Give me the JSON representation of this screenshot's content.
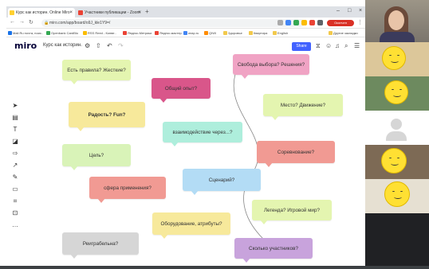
{
  "browser": {
    "tabs": [
      {
        "label": "Курс как историн. Online Miro",
        "favicon_color": "#ffd02f",
        "active": true
      },
      {
        "label": "Участники публикации - Zoom",
        "favicon_color": "#ea4335",
        "active": false
      }
    ],
    "url": "miro.com/app/board/o9J_kle1Y9=/",
    "profile_label": "Окончен",
    "bookmarks": [
      {
        "label": "Mail.Ru почта, поис..",
        "color": "#1a73e8"
      },
      {
        "label": "Openbank CardBlo",
        "color": "#34a853"
      },
      {
        "label": "RSS Reed - Конве..",
        "color": "#fbbc04"
      },
      {
        "label": "Яндекс.Метрики",
        "color": "#ea4335"
      },
      {
        "label": "Яндекс.мастер",
        "color": "#ea4335"
      },
      {
        "label": "wrap.ru",
        "color": "#4285f4"
      },
      {
        "label": "QIWI",
        "color": "#ff8c00"
      },
      {
        "label": "Здоровье",
        "color": "#f2c94c"
      },
      {
        "label": "Квартира",
        "color": "#f2c94c"
      },
      {
        "label": "English",
        "color": "#f2c94c"
      },
      {
        "label": "Другие закладки",
        "color": "#f2c94c"
      }
    ]
  },
  "miro": {
    "logo": "miro",
    "board_name": "Курс как историн.",
    "share_label": "Share"
  },
  "notes": [
    {
      "text": "Есть правила? Жесткие?",
      "color": "#e4f5b0",
      "tail": "left"
    },
    {
      "text": "Общий опыт?",
      "color": "#d9568a",
      "tail": "left"
    },
    {
      "text": "Свобода выбора? Решения?",
      "color": "#f0a3c4",
      "tail": "left"
    },
    {
      "text": "Радость? Fun?",
      "color": "#f7e99b",
      "tail": "left",
      "bold": true
    },
    {
      "text": "Место? Движение?",
      "color": "#e4f5b0",
      "tail": "left"
    },
    {
      "text": "взаимодействие через...?",
      "color": "#aeeedc",
      "tail": "left"
    },
    {
      "text": "Цель?",
      "color": "#d9f3b8",
      "tail": "left"
    },
    {
      "text": "Соревнование?",
      "color": "#f19a93",
      "tail": "left"
    },
    {
      "text": "Сценарий?",
      "color": "#b3dcf5",
      "tail": "left"
    },
    {
      "text": "сфера применения?",
      "color": "#f19a93",
      "tail": "left"
    },
    {
      "text": "Легенда? Игровой мир?",
      "color": "#e4f5b0",
      "tail": "left"
    },
    {
      "text": "Оборудование, атрибуты?",
      "color": "#f7e99b",
      "tail": "left"
    },
    {
      "text": "Реиграбельна?",
      "color": "#d6d6d6",
      "tail": "left"
    },
    {
      "text": "Сколько участников?",
      "color": "#c8a3dc",
      "tail": "left"
    }
  ],
  "participants": [
    {
      "type": "camera"
    },
    {
      "type": "smiley"
    },
    {
      "type": "smiley"
    },
    {
      "type": "avatar"
    },
    {
      "type": "smiley"
    },
    {
      "type": "smiley"
    }
  ]
}
